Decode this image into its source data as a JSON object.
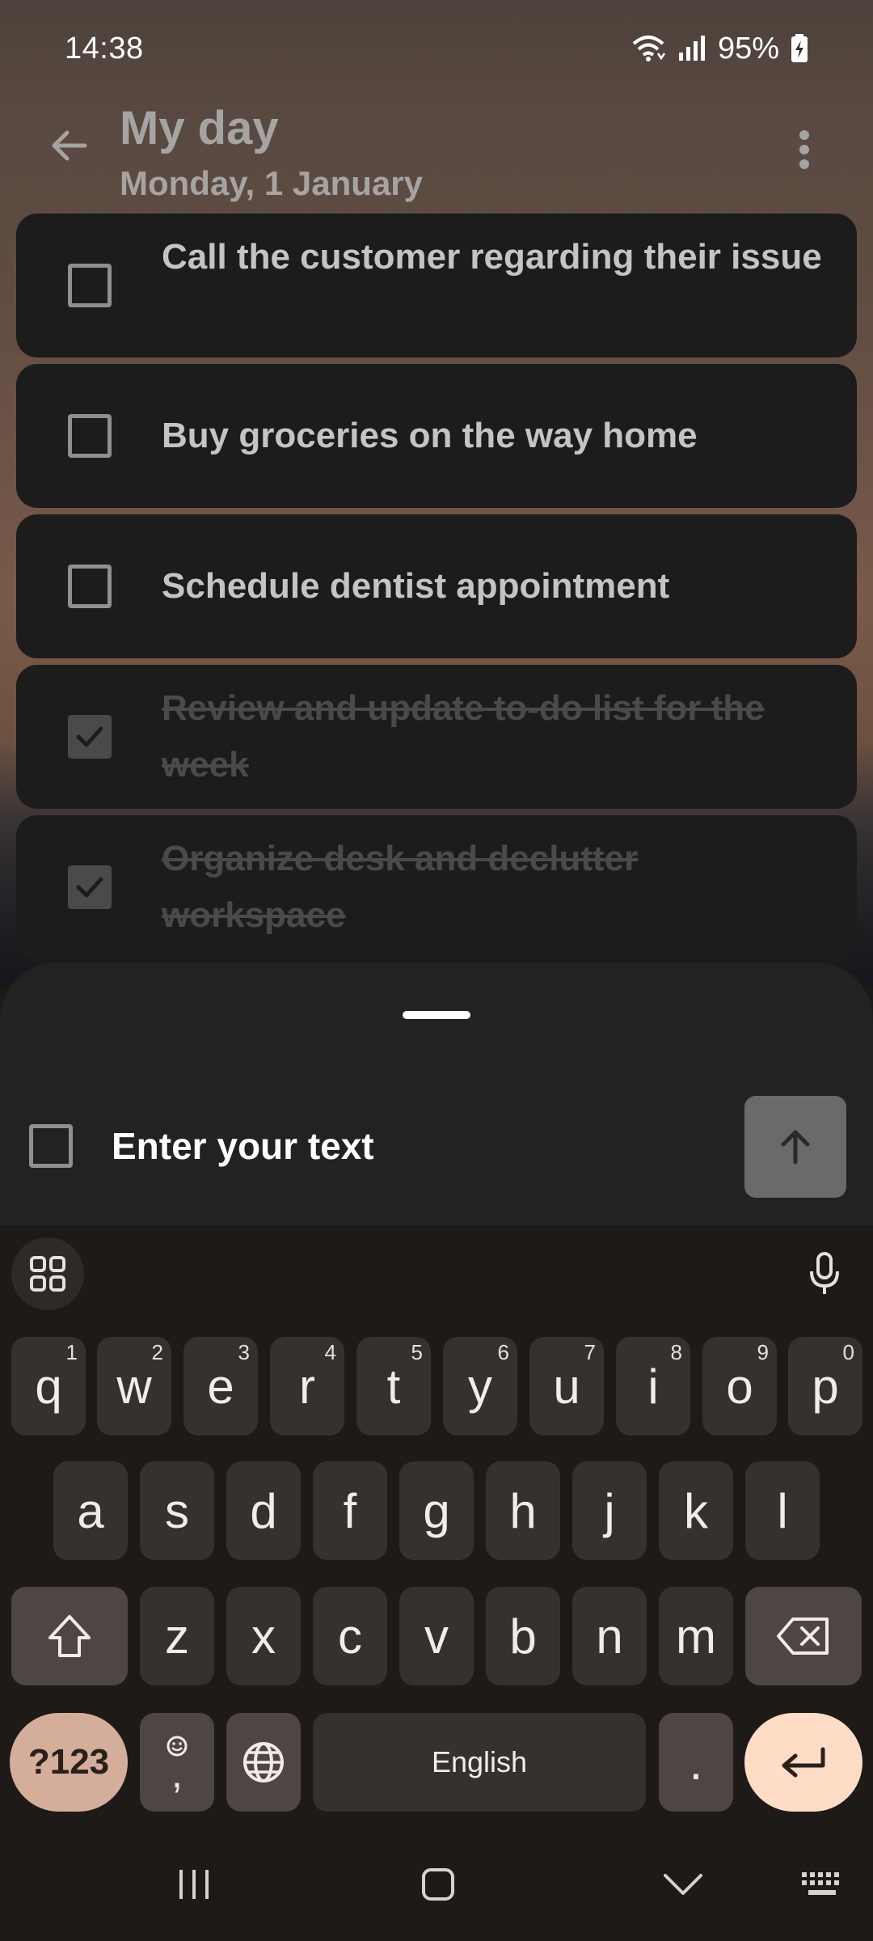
{
  "status_bar": {
    "time": "14:38",
    "battery": "95%",
    "icons": [
      "wifi-icon",
      "signal-icon",
      "battery-charging-icon"
    ]
  },
  "header": {
    "title": "My day",
    "subtitle": "Monday, 1 January",
    "icons": [
      "back-arrow-icon",
      "more-vert-icon"
    ]
  },
  "tasks": [
    {
      "text": "Call the customer regarding their issue",
      "done": false
    },
    {
      "text": "Buy groceries on the way home",
      "done": false
    },
    {
      "text": "Schedule dentist appointment",
      "done": false
    },
    {
      "text": "Review and update to-do list for the week",
      "done": true
    },
    {
      "text": "Organize desk and declutter workspace",
      "done": true
    }
  ],
  "entry": {
    "placeholder": "Enter your text",
    "send_icon": "arrow-up-icon"
  },
  "keyboard": {
    "row1": [
      {
        "key": "q",
        "hint": "1"
      },
      {
        "key": "w",
        "hint": "2"
      },
      {
        "key": "e",
        "hint": "3"
      },
      {
        "key": "r",
        "hint": "4"
      },
      {
        "key": "t",
        "hint": "5"
      },
      {
        "key": "y",
        "hint": "6"
      },
      {
        "key": "u",
        "hint": "7"
      },
      {
        "key": "i",
        "hint": "8"
      },
      {
        "key": "o",
        "hint": "9"
      },
      {
        "key": "p",
        "hint": "0"
      }
    ],
    "row2": [
      "a",
      "s",
      "d",
      "f",
      "g",
      "h",
      "j",
      "k",
      "l"
    ],
    "row3": [
      "z",
      "x",
      "c",
      "v",
      "b",
      "n",
      "m"
    ],
    "symbols_label": "?123",
    "comma_label": ",",
    "space_label": "English",
    "period_label": ".",
    "colors": {
      "accent": "#d5ae9b",
      "enter": "#ffdcc6",
      "key": "#36312e"
    }
  },
  "navbar": {
    "icons": [
      "recents-icon",
      "home-icon",
      "hide-keyboard-icon",
      "keyboard-switch-icon"
    ]
  }
}
